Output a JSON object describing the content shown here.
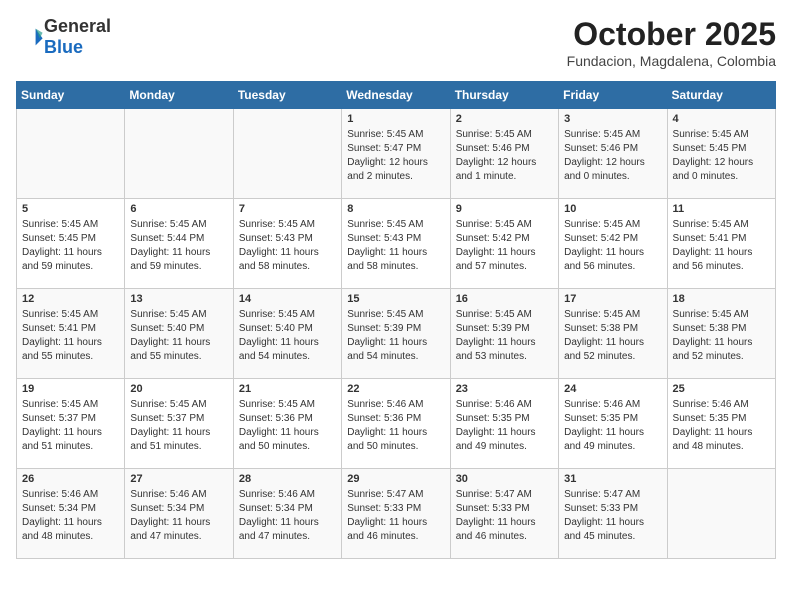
{
  "header": {
    "logo_general": "General",
    "logo_blue": "Blue",
    "title": "October 2025",
    "subtitle": "Fundacion, Magdalena, Colombia"
  },
  "days_of_week": [
    "Sunday",
    "Monday",
    "Tuesday",
    "Wednesday",
    "Thursday",
    "Friday",
    "Saturday"
  ],
  "weeks": [
    [
      {
        "day": "",
        "content": ""
      },
      {
        "day": "",
        "content": ""
      },
      {
        "day": "",
        "content": ""
      },
      {
        "day": "1",
        "content": "Sunrise: 5:45 AM\nSunset: 5:47 PM\nDaylight: 12 hours\nand 2 minutes."
      },
      {
        "day": "2",
        "content": "Sunrise: 5:45 AM\nSunset: 5:46 PM\nDaylight: 12 hours\nand 1 minute."
      },
      {
        "day": "3",
        "content": "Sunrise: 5:45 AM\nSunset: 5:46 PM\nDaylight: 12 hours\nand 0 minutes."
      },
      {
        "day": "4",
        "content": "Sunrise: 5:45 AM\nSunset: 5:45 PM\nDaylight: 12 hours\nand 0 minutes."
      }
    ],
    [
      {
        "day": "5",
        "content": "Sunrise: 5:45 AM\nSunset: 5:45 PM\nDaylight: 11 hours\nand 59 minutes."
      },
      {
        "day": "6",
        "content": "Sunrise: 5:45 AM\nSunset: 5:44 PM\nDaylight: 11 hours\nand 59 minutes."
      },
      {
        "day": "7",
        "content": "Sunrise: 5:45 AM\nSunset: 5:43 PM\nDaylight: 11 hours\nand 58 minutes."
      },
      {
        "day": "8",
        "content": "Sunrise: 5:45 AM\nSunset: 5:43 PM\nDaylight: 11 hours\nand 58 minutes."
      },
      {
        "day": "9",
        "content": "Sunrise: 5:45 AM\nSunset: 5:42 PM\nDaylight: 11 hours\nand 57 minutes."
      },
      {
        "day": "10",
        "content": "Sunrise: 5:45 AM\nSunset: 5:42 PM\nDaylight: 11 hours\nand 56 minutes."
      },
      {
        "day": "11",
        "content": "Sunrise: 5:45 AM\nSunset: 5:41 PM\nDaylight: 11 hours\nand 56 minutes."
      }
    ],
    [
      {
        "day": "12",
        "content": "Sunrise: 5:45 AM\nSunset: 5:41 PM\nDaylight: 11 hours\nand 55 minutes."
      },
      {
        "day": "13",
        "content": "Sunrise: 5:45 AM\nSunset: 5:40 PM\nDaylight: 11 hours\nand 55 minutes."
      },
      {
        "day": "14",
        "content": "Sunrise: 5:45 AM\nSunset: 5:40 PM\nDaylight: 11 hours\nand 54 minutes."
      },
      {
        "day": "15",
        "content": "Sunrise: 5:45 AM\nSunset: 5:39 PM\nDaylight: 11 hours\nand 54 minutes."
      },
      {
        "day": "16",
        "content": "Sunrise: 5:45 AM\nSunset: 5:39 PM\nDaylight: 11 hours\nand 53 minutes."
      },
      {
        "day": "17",
        "content": "Sunrise: 5:45 AM\nSunset: 5:38 PM\nDaylight: 11 hours\nand 52 minutes."
      },
      {
        "day": "18",
        "content": "Sunrise: 5:45 AM\nSunset: 5:38 PM\nDaylight: 11 hours\nand 52 minutes."
      }
    ],
    [
      {
        "day": "19",
        "content": "Sunrise: 5:45 AM\nSunset: 5:37 PM\nDaylight: 11 hours\nand 51 minutes."
      },
      {
        "day": "20",
        "content": "Sunrise: 5:45 AM\nSunset: 5:37 PM\nDaylight: 11 hours\nand 51 minutes."
      },
      {
        "day": "21",
        "content": "Sunrise: 5:45 AM\nSunset: 5:36 PM\nDaylight: 11 hours\nand 50 minutes."
      },
      {
        "day": "22",
        "content": "Sunrise: 5:46 AM\nSunset: 5:36 PM\nDaylight: 11 hours\nand 50 minutes."
      },
      {
        "day": "23",
        "content": "Sunrise: 5:46 AM\nSunset: 5:35 PM\nDaylight: 11 hours\nand 49 minutes."
      },
      {
        "day": "24",
        "content": "Sunrise: 5:46 AM\nSunset: 5:35 PM\nDaylight: 11 hours\nand 49 minutes."
      },
      {
        "day": "25",
        "content": "Sunrise: 5:46 AM\nSunset: 5:35 PM\nDaylight: 11 hours\nand 48 minutes."
      }
    ],
    [
      {
        "day": "26",
        "content": "Sunrise: 5:46 AM\nSunset: 5:34 PM\nDaylight: 11 hours\nand 48 minutes."
      },
      {
        "day": "27",
        "content": "Sunrise: 5:46 AM\nSunset: 5:34 PM\nDaylight: 11 hours\nand 47 minutes."
      },
      {
        "day": "28",
        "content": "Sunrise: 5:46 AM\nSunset: 5:34 PM\nDaylight: 11 hours\nand 47 minutes."
      },
      {
        "day": "29",
        "content": "Sunrise: 5:47 AM\nSunset: 5:33 PM\nDaylight: 11 hours\nand 46 minutes."
      },
      {
        "day": "30",
        "content": "Sunrise: 5:47 AM\nSunset: 5:33 PM\nDaylight: 11 hours\nand 46 minutes."
      },
      {
        "day": "31",
        "content": "Sunrise: 5:47 AM\nSunset: 5:33 PM\nDaylight: 11 hours\nand 45 minutes."
      },
      {
        "day": "",
        "content": ""
      }
    ]
  ]
}
